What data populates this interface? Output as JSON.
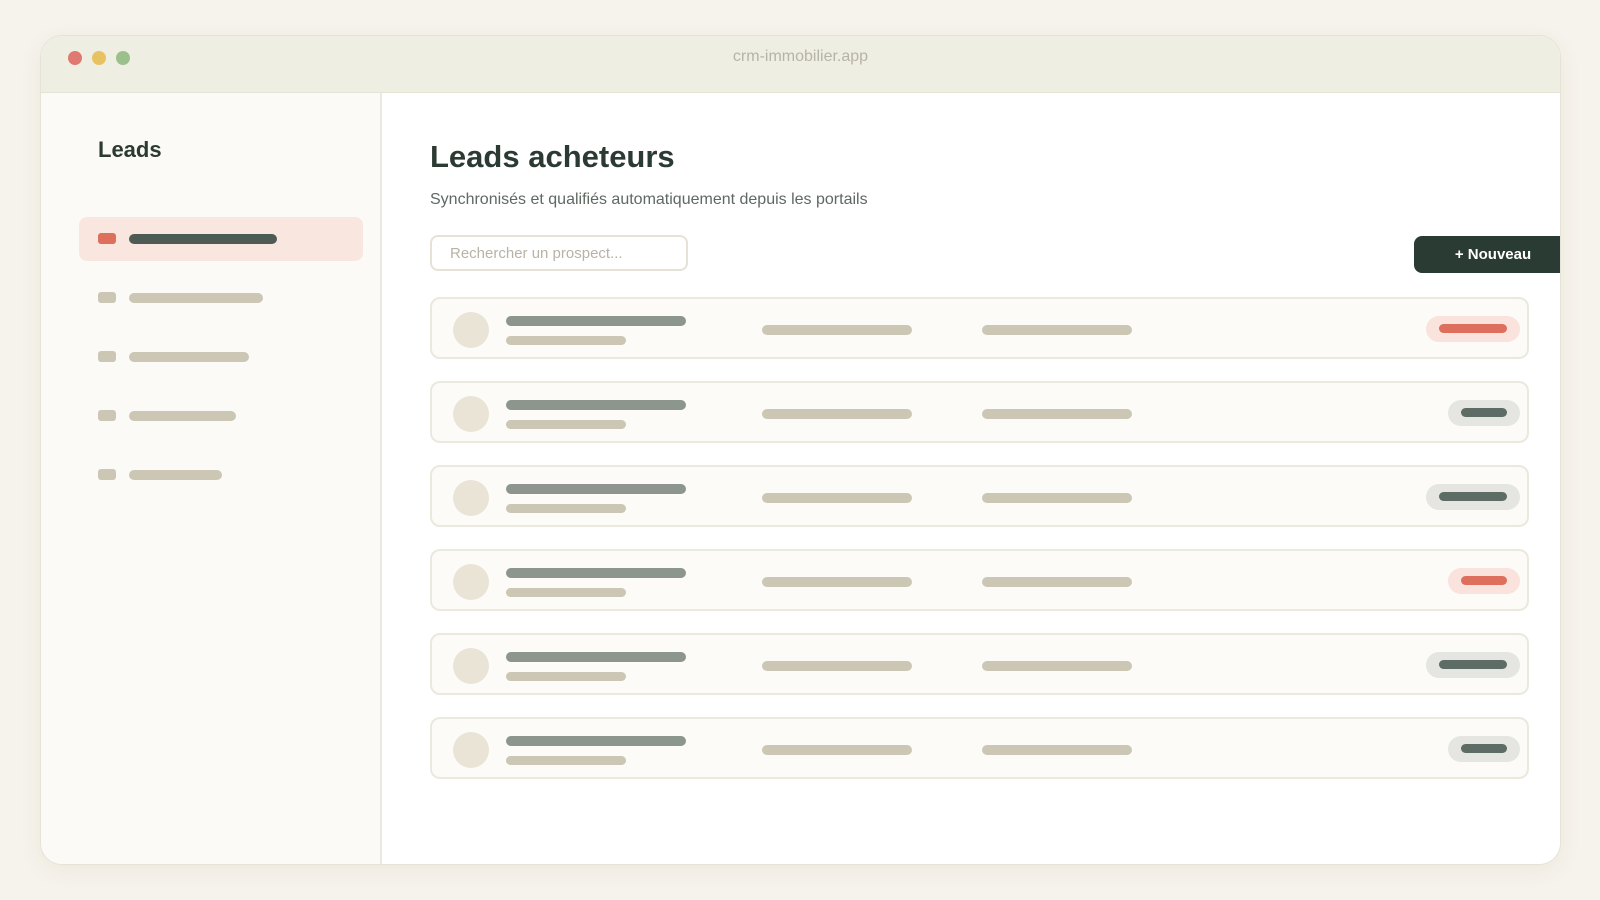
{
  "window": {
    "url": "crm-immobilier.app"
  },
  "sidebar": {
    "title": "Leads",
    "items": [
      {
        "state": "active",
        "label_style": "placeholder"
      },
      {
        "state": "inactive",
        "label_style": "placeholder"
      },
      {
        "state": "inactive",
        "label_style": "placeholder"
      },
      {
        "state": "inactive",
        "label_style": "placeholder"
      },
      {
        "state": "inactive",
        "label_style": "placeholder"
      }
    ]
  },
  "main": {
    "title": "Leads acheteurs",
    "subtitle": "Synchronisés et qualifiés automatiquement depuis les portails",
    "search": {
      "placeholder": "Rechercher un prospect..."
    },
    "new_button_label": "+ Nouveau",
    "rows": [
      {
        "status_color": "red"
      },
      {
        "status_color": "gray"
      },
      {
        "status_color": "gray"
      },
      {
        "status_color": "red"
      },
      {
        "status_color": "gray"
      },
      {
        "status_color": "gray"
      }
    ]
  },
  "colors": {
    "accent": "#dd6f5c",
    "primary_button": "#2a3b33",
    "status_neutral": "#5d6c64",
    "window_dots": [
      "#e07a70",
      "#e8c260",
      "#9cc08c"
    ]
  }
}
